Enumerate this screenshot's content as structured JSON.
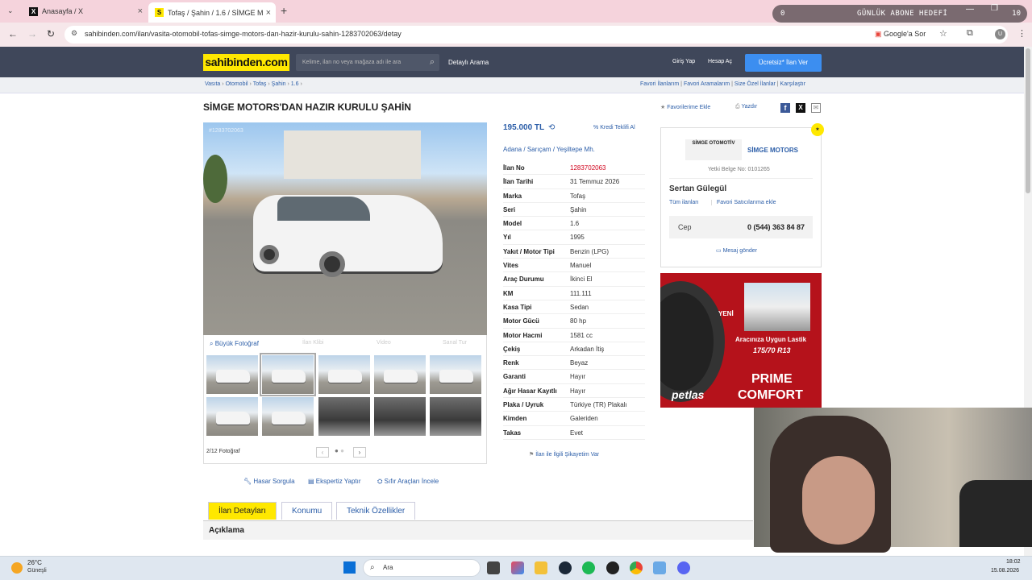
{
  "browser": {
    "tabs": [
      {
        "title": "Anasayfa / X"
      },
      {
        "title": "Tofaş / Şahin / 1.6 / SİMGE MOTORS"
      }
    ],
    "url": "sahibinden.com/ilan/vasita-otomobil-tofas-simge-motors-dan-hazir-kurulu-sahin-1283702063/detay",
    "google_sor": "Google'a Sor",
    "profile_initial": "U"
  },
  "overlay": {
    "abone_left": "0",
    "abone_title": "GÜNLÜK ABONE HEDEFİ",
    "abone_right": "10"
  },
  "site": {
    "logo": "sahibinden.com",
    "search_placeholder": "Kelime, ilan no veya mağaza adı ile ara",
    "detayli_arama": "Detaylı Arama",
    "giris": "Giriş Yap",
    "hesap_ac": "Hesap Aç",
    "ilan_ver": "Ücretsiz* İlan Ver"
  },
  "breadcrumb": [
    "Vasıta",
    "Otomobil",
    "Tofaş",
    "Şahin",
    "1.6"
  ],
  "subnav": [
    "Favori İlanlarım",
    "Favori Aramalarım",
    "Size Özel İlanlar",
    "Karşılaştır"
  ],
  "listing": {
    "title": "SİMGE MOTORS'DAN HAZIR KURULU ŞAHİN",
    "favorite": "Favorilerime Ekle",
    "print": "Yazdır",
    "watermark": "#1283702063",
    "price": "195.000 TL",
    "kredi": "Kredi Teklifi Al",
    "location": [
      "Adana",
      "Sarıçam",
      "Yeşiltepe Mh."
    ],
    "details": [
      {
        "k": "İlan No",
        "v": "1283702063"
      },
      {
        "k": "İlan Tarihi",
        "v": "31 Temmuz 2026"
      },
      {
        "k": "Marka",
        "v": "Tofaş"
      },
      {
        "k": "Seri",
        "v": "Şahin"
      },
      {
        "k": "Model",
        "v": "1.6"
      },
      {
        "k": "Yıl",
        "v": "1995"
      },
      {
        "k": "Yakıt / Motor Tipi",
        "v": "Benzin (LPG)"
      },
      {
        "k": "Vites",
        "v": "Manuel"
      },
      {
        "k": "Araç Durumu",
        "v": "İkinci El"
      },
      {
        "k": "KM",
        "v": "111.111"
      },
      {
        "k": "Kasa Tipi",
        "v": "Sedan"
      },
      {
        "k": "Motor Gücü",
        "v": "80 hp"
      },
      {
        "k": "Motor Hacmi",
        "v": "1581 cc"
      },
      {
        "k": "Çekiş",
        "v": "Arkadan İtiş"
      },
      {
        "k": "Renk",
        "v": "Beyaz"
      },
      {
        "k": "Garanti",
        "v": "Hayır"
      },
      {
        "k": "Ağır Hasar Kayıtlı",
        "v": "Hayır"
      },
      {
        "k": "Plaka / Uyruk",
        "v": "Türkiye (TR) Plakalı"
      },
      {
        "k": "Kimden",
        "v": "Galeriden"
      },
      {
        "k": "Takas",
        "v": "Evet"
      }
    ],
    "sikayet": "İlan ile İlgili Şikayetim Var",
    "photo_tabs": [
      "Büyük Fotoğraf",
      "İlan Klibi",
      "Video",
      "Sanal Tur"
    ],
    "photo_count": "2/12 Fotoğraf",
    "actions": [
      "Hasar Sorgula",
      "Ekspertiz Yaptır",
      "Sıfır Araçları İncele"
    ]
  },
  "seller": {
    "store_logo_text": "SİMGE OTOMOTİV",
    "store_name": "SİMGE MOTORS",
    "yetki": "Yetki Belge No: 0101265",
    "person": "Sertan Gülegül",
    "tum_ilanlari": "Tüm ilanları",
    "favori_satici": "Favori Satıcılarıma ekle",
    "cep_label": "Cep",
    "cep_number": "0 (544) 363 84 87",
    "mesaj": "Mesaj gönder"
  },
  "ad": {
    "badge": "YENİ",
    "line1": "Aracınıza Uygun Lastik",
    "line2": "175/70 R13",
    "brand": "petlas",
    "product1": "PRIME",
    "product2": "COMFORT"
  },
  "bottom_tabs": [
    "İlan Detayları",
    "Konumu",
    "Teknik Özellikler"
  ],
  "aciklama": "Açıklama",
  "taskbar": {
    "weather_temp": "26°C",
    "weather_desc": "Güneşli",
    "search": "Ara",
    "time": "18:02",
    "date": "15.08.2026"
  }
}
